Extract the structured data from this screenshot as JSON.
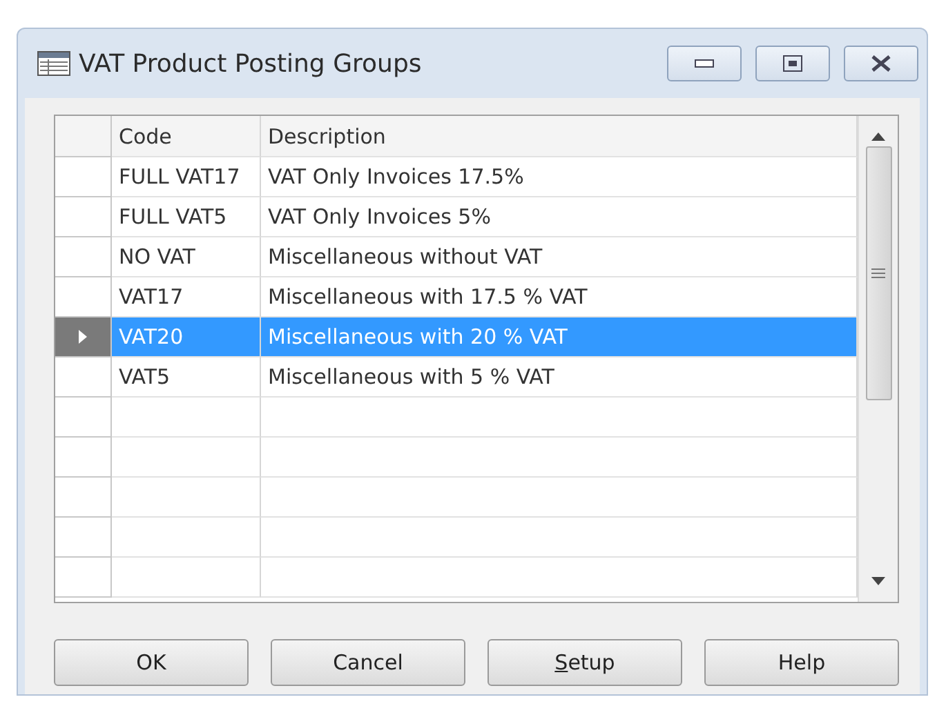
{
  "window": {
    "title": "VAT Product Posting Groups"
  },
  "table": {
    "columns": [
      "Code",
      "Description"
    ],
    "rows": [
      {
        "code": "FULL VAT17",
        "description": "VAT Only Invoices 17.5%",
        "selected": false
      },
      {
        "code": "FULL VAT5",
        "description": "VAT Only Invoices 5%",
        "selected": false
      },
      {
        "code": "NO VAT",
        "description": "Miscellaneous without VAT",
        "selected": false
      },
      {
        "code": "VAT17",
        "description": "Miscellaneous with 17.5 % VAT",
        "selected": false
      },
      {
        "code": "VAT20",
        "description": "Miscellaneous with 20 % VAT",
        "selected": true
      },
      {
        "code": "VAT5",
        "description": "Miscellaneous with 5 % VAT",
        "selected": false
      }
    ]
  },
  "buttons": [
    {
      "label": "OK",
      "mnemonic": false
    },
    {
      "label": "Cancel",
      "mnemonic": false
    },
    {
      "label": "Setup",
      "mnemonic": true
    },
    {
      "label": "Help",
      "mnemonic": false
    }
  ]
}
